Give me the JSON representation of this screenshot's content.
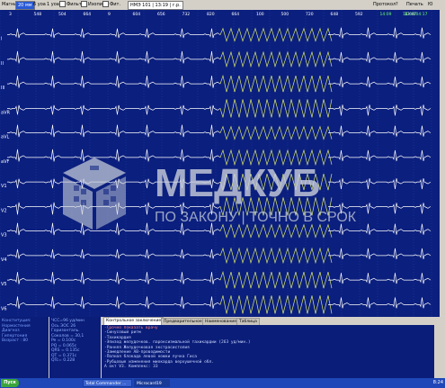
{
  "toolbar": {
    "mag_label": "Магнит",
    "mag_value": "20 мм",
    "amp_label": "6 уоа",
    "gain_label": "1 уоа",
    "filter1": "Фильтр",
    "filter2": "Изопин",
    "filter3": "Фит.",
    "record": "НМЭ 101 | 13:19 | г.р.",
    "protocol": "Протокол",
    "help_icon": "?",
    "print": "Печать",
    "unit_icon": "Ю",
    "checked_value": "ᵐ"
  },
  "ecg": {
    "leads": [
      "I",
      "II",
      "III",
      "aVR",
      "aVL",
      "aVF",
      "V1",
      "V2",
      "V3",
      "V4",
      "V5",
      "V6"
    ],
    "times": [
      "3",
      "548",
      "504",
      "664",
      "9",
      "604",
      "656",
      "732",
      "820",
      "664",
      "100",
      "500",
      "720",
      "648",
      "592",
      "14:09",
      "13:47"
    ],
    "time_highlight": "14:09:04:17"
  },
  "left_panel": {
    "lines": [
      "Конституция:",
      "Нормостения",
      "Диагноз",
      "Гипертония",
      "Возраст : 80"
    ]
  },
  "mid_panel": {
    "lines": [
      "ЧСС=96 уд/мин",
      "Ось ЭОС 26",
      "Горизонталь.",
      "Соколов = 30,1",
      "Pe = 0.100с",
      "PQ = 0.065с",
      "QRS = 0.135с",
      "QT = 0.371с",
      "QTc= 0.228"
    ]
  },
  "tabs": [
    "Контрольное заключение",
    "Предварительное",
    "Наименование",
    "Таблица"
  ],
  "conclusion": {
    "lines": [
      "-Срочно показать врачу",
      "-Синусовый ритм",
      "-Тахикардия",
      "-Эпизод желудочков. пароксизмальной тахикардии (263 уд/мин.)",
      "-Ранняя Желудочковая экстрасистолия",
      "-Замедление АВ-проводимости",
      "-Полная блокада левой ножки пучка Гиса",
      "-Рубцовые изменения миокарда верхушечной обл.",
      "А окт V3. Комплекс: 33"
    ]
  },
  "watermark": {
    "title": "МЕДКУБ",
    "subtitle": "ПО ЗАКОНУ | ТОЧНО В СРОК"
  },
  "taskbar": {
    "start": "Пуск",
    "tasks": [
      "Total Commander ...",
      "Microcard19"
    ],
    "clock": "8:24"
  },
  "colors": {
    "background": "#0b1f7e",
    "grid": "#2c4cb0",
    "trace": "#ffffff",
    "trace_highlight": "#d8e66a",
    "watermark": "#c9cfdc"
  }
}
